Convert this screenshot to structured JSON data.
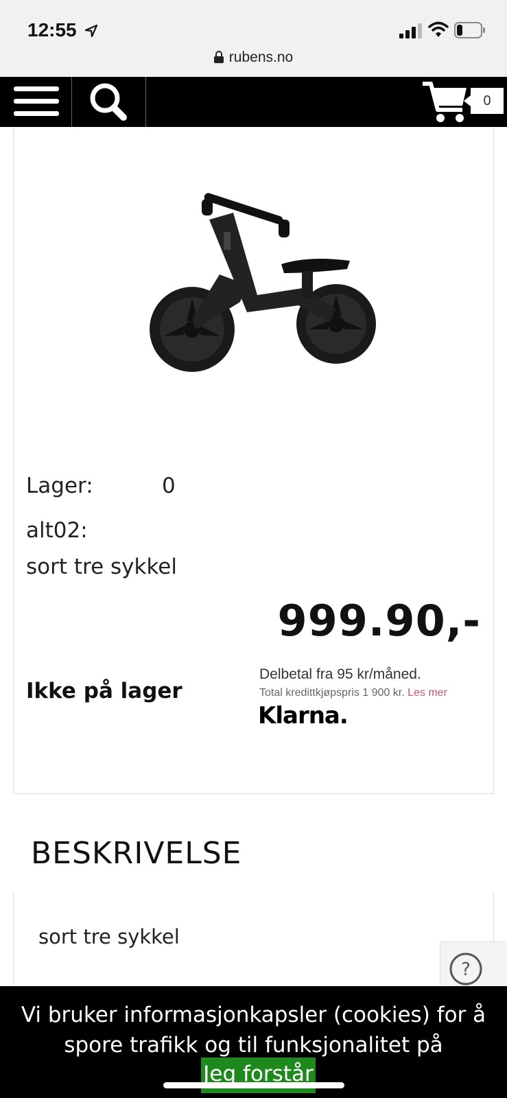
{
  "status_bar": {
    "time": "12:55",
    "url": "rubens.no",
    "icons": [
      "location-arrow-icon",
      "signal-icon",
      "wifi-icon",
      "battery-icon",
      "lock-icon"
    ]
  },
  "nav": {
    "icons": [
      "menu-icon",
      "search-icon",
      "cart-icon"
    ],
    "cart_count": "0"
  },
  "product": {
    "image": "balance-bike-image",
    "lager_label": "Lager:",
    "lager_value": "0",
    "alt_label": "alt02:",
    "alt_value": "sort tre sykkel",
    "price": "999.90,-",
    "stock_status": "Ikke på lager"
  },
  "klarna": {
    "line1": "Delbetal fra 95 kr/måned.",
    "line2": "Total kredittkjøpspris 1 900 kr.",
    "link": "Les mer",
    "logo": "Klarna.",
    "link_color": "#c8557a"
  },
  "description": {
    "heading": "BESKRIVELSE",
    "text": "sort tre sykkel"
  },
  "help": {
    "icon": "question-icon"
  },
  "cookie": {
    "text": "Vi bruker informasjonkapsler (cookies) for å spore trafikk og til funksjonalitet på nettsiden",
    "button": "Jeg forstår",
    "button_color": "#1e8a1e"
  }
}
